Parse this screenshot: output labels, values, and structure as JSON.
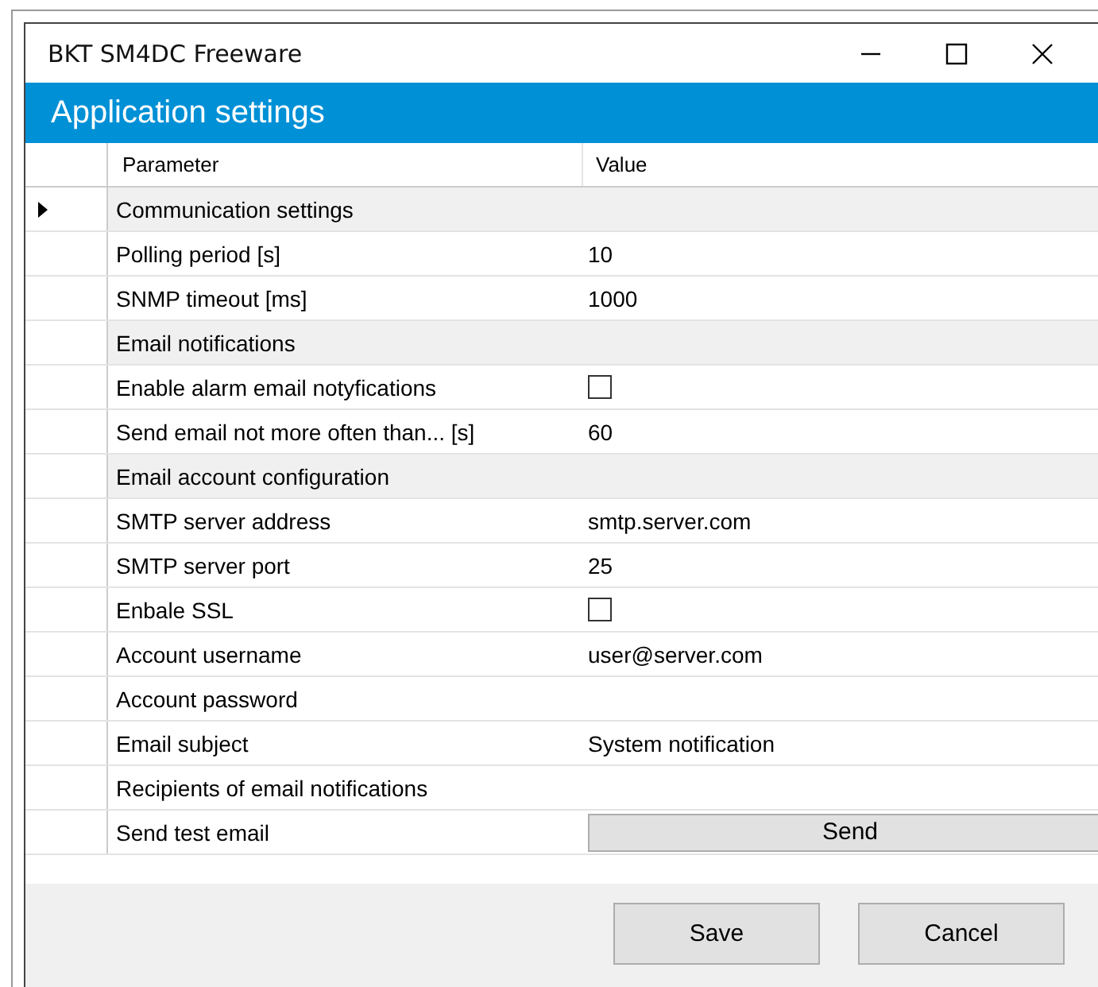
{
  "window": {
    "title": "BKT SM4DC Freeware"
  },
  "header": {
    "title": "Application settings"
  },
  "table": {
    "columns": [
      "Parameter",
      "Value"
    ],
    "rows": [
      {
        "kind": "category",
        "parameter": "Communication settings",
        "selected": true
      },
      {
        "kind": "text",
        "parameter": "Polling period [s]",
        "value": "10",
        "selected": false
      },
      {
        "kind": "text",
        "parameter": "SNMP timeout [ms]",
        "value": "1000",
        "selected": false
      },
      {
        "kind": "category",
        "parameter": "Email notifications",
        "selected": false
      },
      {
        "kind": "checkbox",
        "parameter": "Enable alarm email notyfications",
        "checked": false,
        "selected": false
      },
      {
        "kind": "text",
        "parameter": "Send email not more often than... [s]",
        "value": "60",
        "selected": false
      },
      {
        "kind": "category",
        "parameter": "Email account configuration",
        "selected": false
      },
      {
        "kind": "text",
        "parameter": "SMTP server address",
        "value": "smtp.server.com",
        "selected": false
      },
      {
        "kind": "text",
        "parameter": "SMTP server port",
        "value": "25",
        "selected": false
      },
      {
        "kind": "checkbox",
        "parameter": "Enbale SSL",
        "checked": false,
        "selected": false
      },
      {
        "kind": "text",
        "parameter": "Account username",
        "value": "user@server.com",
        "selected": false
      },
      {
        "kind": "text",
        "parameter": "Account password",
        "selected": false
      },
      {
        "kind": "text",
        "parameter": "Email subject",
        "value": "System notification",
        "selected": false
      },
      {
        "kind": "text",
        "parameter": "Recipients of email notifications",
        "selected": false
      },
      {
        "kind": "button",
        "parameter": "Send test email",
        "value": "Send",
        "selected": false
      }
    ]
  },
  "buttons": [
    "Save",
    "Cancel"
  ]
}
